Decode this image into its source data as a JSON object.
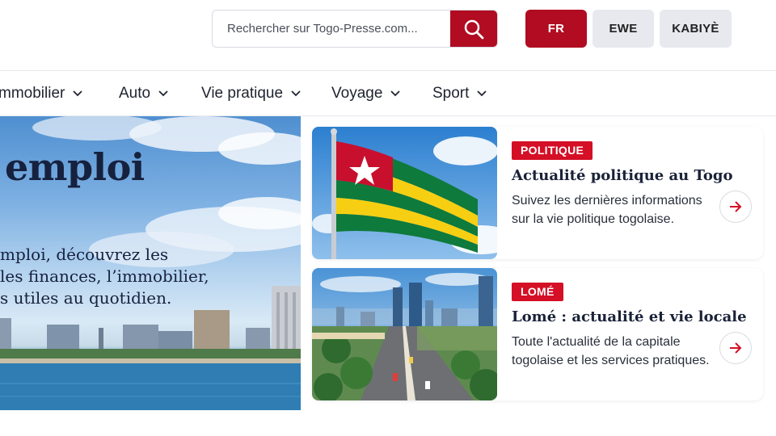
{
  "search": {
    "placeholder": "Rechercher sur Togo-Presse.com...",
    "icon": "search-icon"
  },
  "languages": [
    {
      "label": "FR",
      "active": true
    },
    {
      "label": "EWE",
      "active": false
    },
    {
      "label": "KABIYÈ",
      "active": false
    }
  ],
  "nav": {
    "items": [
      {
        "label": "mmobilier"
      },
      {
        "label": "Auto"
      },
      {
        "label": "Vie pratique"
      },
      {
        "label": "Voyage"
      },
      {
        "label": "Sport"
      }
    ]
  },
  "hero": {
    "title": "emploi",
    "lines": [
      "mploi, découvrez les",
      "les finances, l’immobilier,",
      "s utiles au quotidien."
    ]
  },
  "cards": [
    {
      "badge": "POLITIQUE",
      "title": "Actualité politique au Togo",
      "desc_line1": "Suivez les dernières informations",
      "desc_line2": "sur la vie politique togolaise.",
      "image": "togo-flag-image",
      "arrow": "arrow-right-icon"
    },
    {
      "badge": "LOMÉ",
      "title": "Lomé : actualité et vie locale",
      "desc_line1": "Toute l'actualité de la capitale",
      "desc_line2": "togolaise et les services pratiques.",
      "image": "lome-city-image",
      "arrow": "arrow-right-icon"
    }
  ],
  "colors": {
    "brand_red": "#b10c22",
    "badge_red": "#d40f26",
    "lang_inactive": "#e8e9ee",
    "text_dark": "#16213e"
  }
}
